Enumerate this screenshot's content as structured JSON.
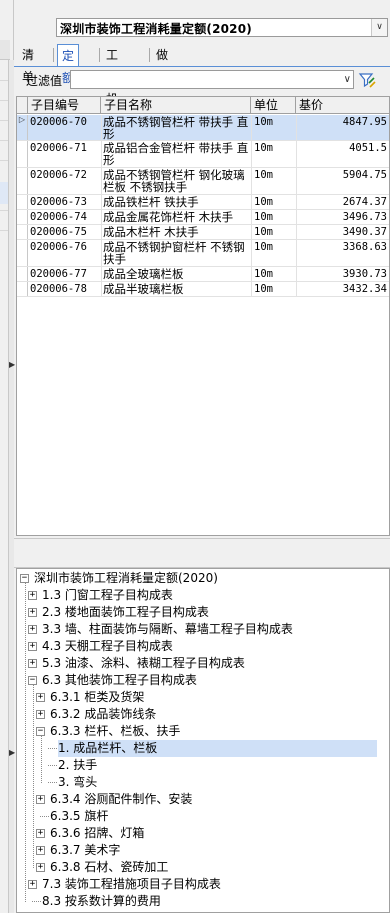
{
  "header": {
    "quota_library": "深圳市装饰工程消耗量定额(2020)",
    "combo_icon": "chevron-down-icon"
  },
  "tabs": [
    {
      "label": "清单"
    },
    {
      "label": "定额"
    },
    {
      "label": "工料机"
    },
    {
      "label": "做法"
    }
  ],
  "filter": {
    "label": "过滤值",
    "value": "",
    "icon": "filter-apply-icon"
  },
  "grid": {
    "columns": [
      "子目编号",
      "子目名称",
      "单位",
      "基价"
    ],
    "rows": [
      {
        "code": "020006-70",
        "name": "成品不锈钢管栏杆 带扶手 直形",
        "unit": "10m",
        "price": "4847.95",
        "selected": true
      },
      {
        "code": "020006-71",
        "name": "成品铝合金管栏杆 带扶手 直形",
        "unit": "10m",
        "price": "4051.5"
      },
      {
        "code": "020006-72",
        "name": "成品不锈钢管栏杆 钢化玻璃栏板 不锈钢扶手",
        "unit": "10m",
        "price": "5904.75"
      },
      {
        "code": "020006-73",
        "name": "成品铁栏杆 铁扶手",
        "unit": "10m",
        "price": "2674.37"
      },
      {
        "code": "020006-74",
        "name": "成品金属花饰栏杆 木扶手",
        "unit": "10m",
        "price": "3496.73"
      },
      {
        "code": "020006-75",
        "name": "成品木栏杆 木扶手",
        "unit": "10m",
        "price": "3490.37"
      },
      {
        "code": "020006-76",
        "name": "成品不锈钢护窗栏杆 不锈钢扶手",
        "unit": "10m",
        "price": "3368.63"
      },
      {
        "code": "020006-77",
        "name": "成品全玻璃栏板",
        "unit": "10m",
        "price": "3930.73"
      },
      {
        "code": "020006-78",
        "name": "成品半玻璃栏板",
        "unit": "10m",
        "price": "3432.34"
      }
    ]
  },
  "tree": {
    "nodes": [
      {
        "label": "深圳市装饰工程消耗量定额(2020)",
        "state": "-"
      },
      {
        "label": "1.3 门窗工程子目构成表",
        "state": "+"
      },
      {
        "label": "2.3 楼地面装饰工程子目构成表",
        "state": "+"
      },
      {
        "label": "3.3 墙、柱面装饰与隔断、幕墙工程子目构成表",
        "state": "+"
      },
      {
        "label": "4.3 天棚工程子目构成表",
        "state": "+"
      },
      {
        "label": "5.3 油漆、涂料、裱糊工程子目构成表",
        "state": "+"
      },
      {
        "label": "6.3 其他装饰工程子目构成表",
        "state": "-"
      },
      {
        "label": "6.3.1 柜类及货架",
        "state": "+"
      },
      {
        "label": "6.3.2 成品装饰线条",
        "state": "+"
      },
      {
        "label": "6.3.3 栏杆、栏板、扶手",
        "state": "-"
      },
      {
        "label": "1. 成品栏杆、栏板",
        "state": "",
        "selected": true
      },
      {
        "label": "2. 扶手",
        "state": ""
      },
      {
        "label": "3. 弯头",
        "state": ""
      },
      {
        "label": "6.3.4 浴厕配件制作、安装",
        "state": "+"
      },
      {
        "label": "6.3.5 旗杆",
        "state": ""
      },
      {
        "label": "6.3.6 招牌、灯箱",
        "state": "+"
      },
      {
        "label": "6.3.7 美术字",
        "state": "+"
      },
      {
        "label": "6.3.8 石材、瓷砖加工",
        "state": "+"
      },
      {
        "label": "7.3 装饰工程措施项目子目构成表",
        "state": "+"
      },
      {
        "label": "8.3 按系数计算的费用",
        "state": ""
      }
    ]
  }
}
